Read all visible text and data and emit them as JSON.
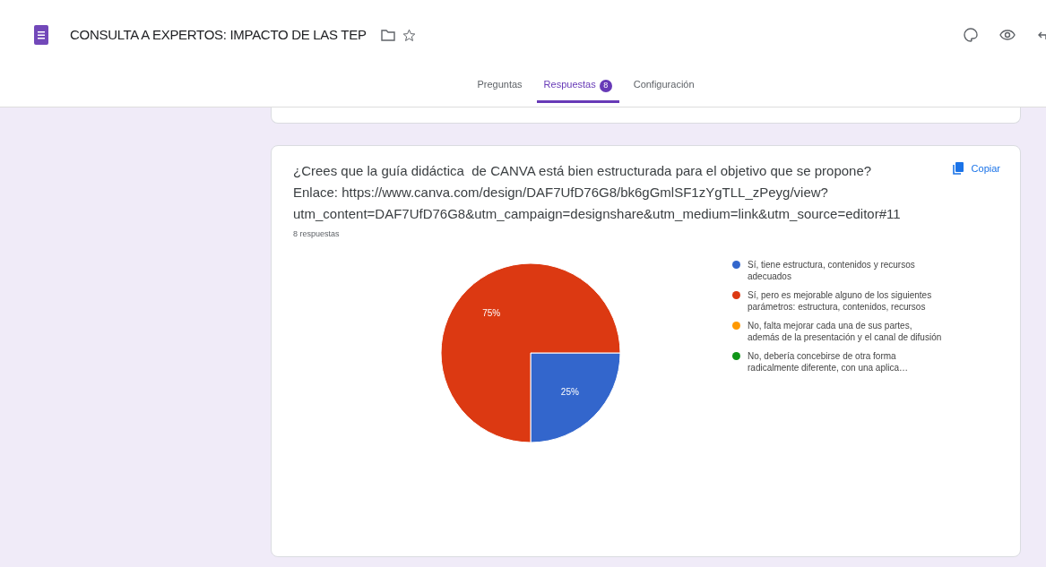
{
  "header": {
    "title": "CONSULTA A EXPERTOS: IMPACTO DE LAS TEP"
  },
  "tabs": [
    {
      "label": "Preguntas",
      "selected": false
    },
    {
      "label": "Respuestas",
      "selected": true,
      "badge": "8"
    },
    {
      "label": "Configuración",
      "selected": false
    }
  ],
  "question": {
    "text": "¿Crees que la guía didáctica  de CANVA está bien estructurada para el objetivo que se propone?\nEnlace: https://www.canva.com/design/DAF7UfD76G8/bk6gGmlSF1zYgTLL_zPeyg/view?\nutm_content=DAF7UfD76G8&utm_campaign=designshare&utm_medium=link&utm_source=editor#11",
    "copy_label": "Copiar",
    "count": "8 respuestas",
    "chart_data": {
      "type": "pie",
      "categories": [
        "Sí, tiene estructura, contenidos y recursos adecuados",
        "Sí, pero es mejorable alguno de los siguientes parámetros: estructura, contenidos, recursos",
        "No, falta mejorar cada una de sus partes, además de la presentación y el canal de difusión",
        "No, debería concebirse de otra forma radicalmente diferente, con una aplica…"
      ],
      "values": [
        25,
        75,
        0,
        0
      ],
      "colors": [
        "#3366cc",
        "#dc3912",
        "#ff9900",
        "#109618"
      ],
      "value_labels": [
        "25%",
        "75%",
        null,
        null
      ]
    }
  }
}
